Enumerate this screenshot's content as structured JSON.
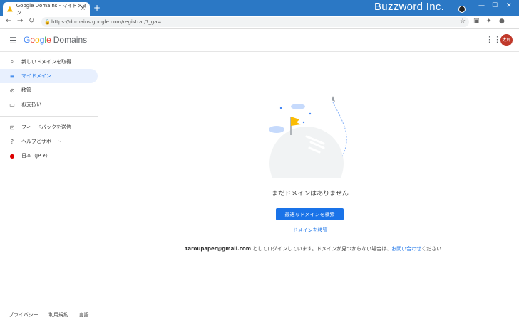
{
  "browser": {
    "tab_title": "Google Domains - マイドメイン",
    "url": "https://domains.google.com/registrar/?_ga=",
    "watermark": "Buzzword Inc."
  },
  "header": {
    "logo_google": [
      "G",
      "o",
      "o",
      "g",
      "l",
      "e"
    ],
    "logo_product": "Domains",
    "avatar_text": "太郎"
  },
  "sidebar": {
    "items": [
      {
        "label": "新しいドメインを取得",
        "icon": "search-icon"
      },
      {
        "label": "マイドメイン",
        "icon": "list-icon"
      },
      {
        "label": "移管",
        "icon": "transfer-icon"
      },
      {
        "label": "お支払い",
        "icon": "card-icon"
      }
    ],
    "secondary": [
      {
        "label": "フィードバックを送信",
        "icon": "feedback-icon"
      },
      {
        "label": "ヘルプとサポート",
        "icon": "help-icon"
      },
      {
        "label": "日本（JP ¥）",
        "icon": "flag-icon"
      }
    ],
    "footer": [
      "プライバシー",
      "利用規約",
      "言語"
    ]
  },
  "main": {
    "empty_message": "まだドメインはありません",
    "primary_button": "最適なドメインを検索",
    "transfer_link": "ドメインを移管",
    "note_email": "taroupaper@gmail.com",
    "note_text": " としてログインしています。ドメインが見つからない場合は、",
    "note_link": "お問い合わせ",
    "note_end": "ください"
  },
  "colors": {
    "accent": "#1a73e8",
    "titlebar": "#2b78c5"
  }
}
